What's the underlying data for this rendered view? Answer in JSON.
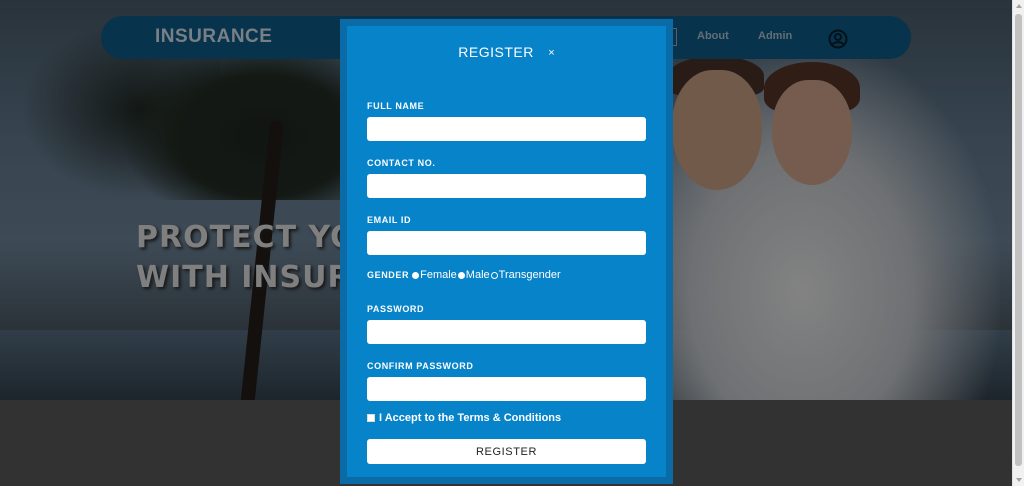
{
  "navbar": {
    "brand": "INSURANCE",
    "links": [
      "About",
      "Admin"
    ],
    "icons": [
      "user-icon"
    ]
  },
  "hero": {
    "title_line1": "PROTECT YO",
    "title_line2": "WITH INSUR"
  },
  "modal": {
    "title": "REGISTER",
    "close_icon": "×",
    "fields": {
      "full_name": {
        "label": "FULL NAME",
        "value": ""
      },
      "contact": {
        "label": "CONTACT NO.",
        "value": ""
      },
      "email": {
        "label": "EMAIL ID",
        "value": ""
      },
      "password": {
        "label": "PASSWORD",
        "value": ""
      },
      "confirm_password": {
        "label": "CONFIRM PASSWORD",
        "value": ""
      }
    },
    "gender": {
      "label": "GENDER",
      "options": [
        "Female",
        "Male",
        "Transgender"
      ],
      "filled": [
        true,
        true,
        false
      ]
    },
    "terms": "I Accept to the Terms & Conditions",
    "terms_checked": false,
    "submit_label": "REGISTER"
  },
  "colors": {
    "modal_bg": "#0683c9",
    "modal_border": "#0b6ba6",
    "navbar_bg": "#0d4f75"
  }
}
